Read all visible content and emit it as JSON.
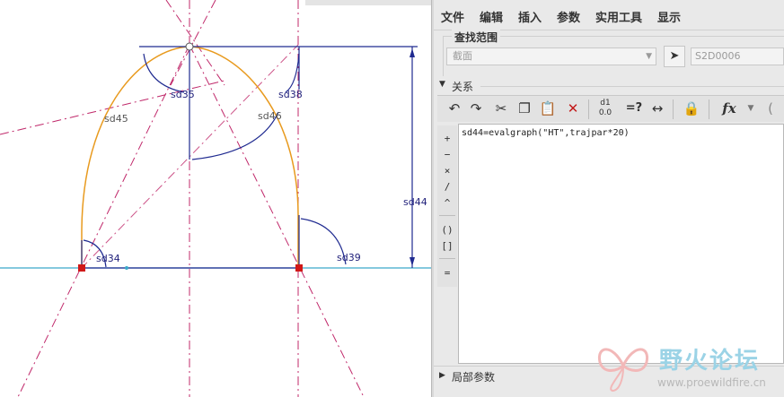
{
  "sketch": {
    "dimensions": [
      "sd35",
      "sd38",
      "sd45",
      "sd46",
      "sd44",
      "sd34",
      "sd39"
    ]
  },
  "menubar": {
    "items": [
      "文件",
      "编辑",
      "插入",
      "参数",
      "实用工具",
      "显示"
    ]
  },
  "scope": {
    "title": "查找范围",
    "select_value": "截面",
    "id_value": "S2D0006"
  },
  "relations": {
    "header": "关系",
    "expression": "sd44=evalgraph(\"HT\",trajpar*20)"
  },
  "toolbar": {
    "icons": [
      "undo-icon",
      "redo-icon",
      "cut-icon",
      "copy-icon",
      "paste-icon",
      "delete-icon",
      "evaluate-icon",
      "verify-icon",
      "measure-icon",
      "lock-icon",
      "function-icon"
    ],
    "verify_label": "=?"
  },
  "operators": [
    "+",
    "−",
    "×",
    "/",
    "^",
    "()",
    "[]",
    "="
  ],
  "local_params": {
    "label": "局部参数"
  },
  "watermark": {
    "title": "野火论坛",
    "url": "www.proewildfire.cn"
  },
  "colors": {
    "curve": "#e89a1e",
    "dimension": "#1f2a90",
    "centerline": "#c0286a",
    "baseline": "#3aa9c9",
    "constraint_marker": "#d01818"
  }
}
